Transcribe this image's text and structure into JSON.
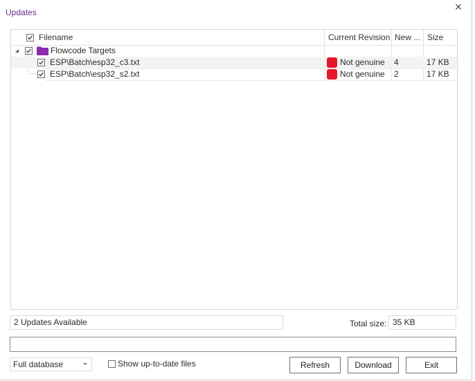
{
  "window": {
    "title": "Updates",
    "close_glyph": "✕"
  },
  "grid": {
    "columns": {
      "filename": "Filename",
      "current_revision": "Current Revision",
      "new": "New ...",
      "size": "Size"
    },
    "group": {
      "label": "Flowcode Targets",
      "checked": true,
      "expanded": true,
      "folder_color": "#8a2cab"
    },
    "rows": [
      {
        "filename": "ESP\\Batch\\esp32_c3.txt",
        "current_revision": "Not genuine",
        "new": "4",
        "size": "17 KB",
        "checked": true,
        "status_color": "#e8162a"
      },
      {
        "filename": "ESP\\Batch\\esp32_s2.txt",
        "current_revision": "Not genuine",
        "new": "2",
        "size": "17 KB",
        "checked": true,
        "status_color": "#e8162a"
      }
    ]
  },
  "footer": {
    "status": "2 Updates Available",
    "total_size_label": "Total size:",
    "total_size": "35 KB",
    "progress_percent": 0,
    "database_option": "Full database",
    "show_uptodate_label": "Show up-to-date files",
    "show_uptodate_checked": false,
    "buttons": {
      "refresh": "Refresh",
      "download": "Download",
      "exit": "Exit"
    }
  }
}
